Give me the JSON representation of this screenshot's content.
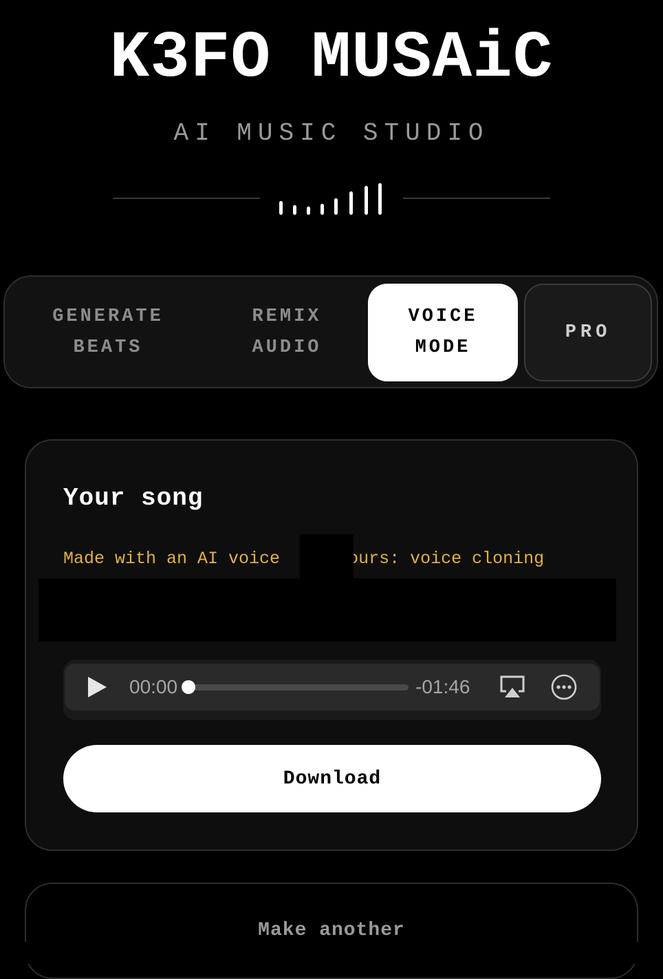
{
  "header": {
    "title": "K3FO MUSAiC",
    "subtitle": "AI MUSIC STUDIO",
    "wave_icon": "waveform-icon"
  },
  "tabs": [
    {
      "line1": "GENERATE",
      "line2": "BEATS",
      "active": false
    },
    {
      "line1": "REMIX",
      "line2": "AUDIO",
      "active": false
    },
    {
      "line1": "VOICE",
      "line2": "MODE",
      "active": true
    },
    {
      "line1": "PRO",
      "line2": "",
      "active": false
    }
  ],
  "card": {
    "title": "Your song",
    "note_part1": "Made with an AI voice",
    "note_part2": "yours: voice cloning",
    "note_color": "#e0b04c"
  },
  "player": {
    "elapsed": "00:00",
    "remaining": "-01:46",
    "progress": 0,
    "play_icon": "play-icon",
    "airplay_icon": "airplay-icon",
    "more_icon": "more-options-icon"
  },
  "actions": {
    "download_label": "Download",
    "make_another_label": "Make another"
  }
}
